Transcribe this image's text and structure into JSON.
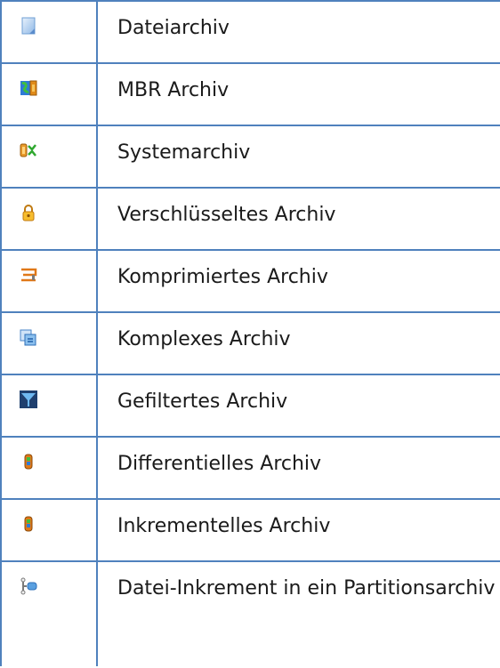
{
  "legend": {
    "rows": [
      {
        "label": "Dateiarchiv",
        "icon": "file-archive-icon"
      },
      {
        "label": "MBR Archiv",
        "icon": "mbr-archive-icon"
      },
      {
        "label": "Systemarchiv",
        "icon": "system-archive-icon"
      },
      {
        "label": "Verschlüsseltes Archiv",
        "icon": "padlock-icon"
      },
      {
        "label": "Komprimiertes Archiv",
        "icon": "clamp-icon"
      },
      {
        "label": "Komplexes Archiv",
        "icon": "complex-archive-icon"
      },
      {
        "label": "Gefiltertes Archiv",
        "icon": "funnel-icon"
      },
      {
        "label": "Differentielles Archiv",
        "icon": "differential-archive-icon"
      },
      {
        "label": "Inkrementelles Archiv",
        "icon": "incremental-archive-icon"
      },
      {
        "label": "Datei-Inkrement in ein Partitionsarchiv",
        "icon": "file-increment-icon"
      }
    ]
  },
  "colors": {
    "border": "#4f81bd",
    "text": "#1a1a1a"
  }
}
